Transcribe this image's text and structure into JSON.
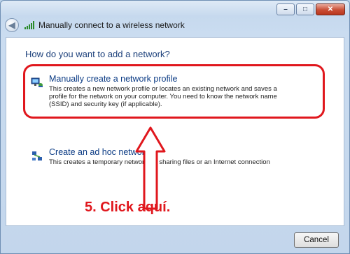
{
  "window": {
    "title": "Manually connect to a wireless network",
    "controls": {
      "minimize": "–",
      "maximize": "□",
      "close": "✕"
    }
  },
  "main": {
    "heading": "How do you want to add a network?",
    "options": [
      {
        "title": "Manually create a network profile",
        "description": "This creates a new network profile or locates an existing network and saves a profile for the network on your computer. You need to know the network name (SSID) and security key (if applicable).",
        "icon": "network-profile-icon"
      },
      {
        "title": "Create an ad hoc network",
        "description": "This creates a temporary network for sharing files or an Internet connection",
        "icon": "ad-hoc-network-icon"
      }
    ]
  },
  "annotation": {
    "text": "5. Click aquí.",
    "color": "#e0171d"
  },
  "footer": {
    "cancel_label": "Cancel"
  }
}
